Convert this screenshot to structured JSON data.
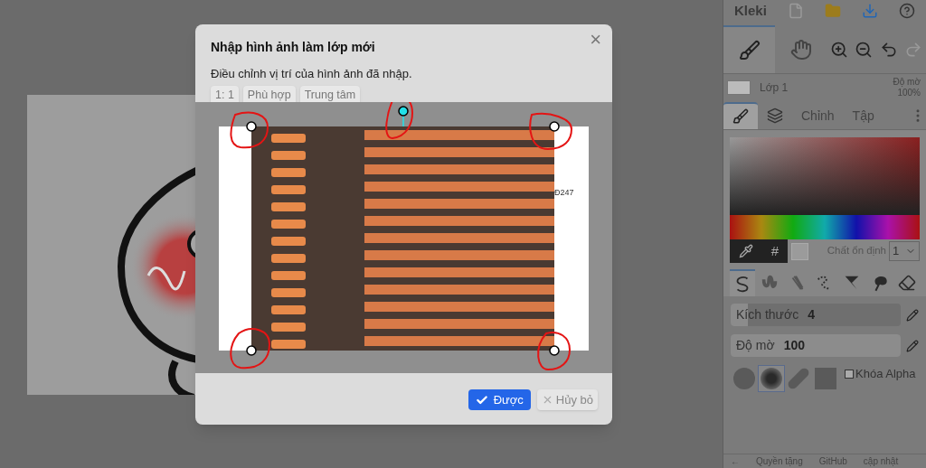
{
  "dialog": {
    "title": "Nhập hình ảnh làm lớp mới",
    "subtitle": "Điều chỉnh vị trí của hình ảnh đã nhập.",
    "close": "×",
    "fit_buttons": [
      "1: 1",
      "Phù hợp",
      "Trung tâm"
    ],
    "canvas_label": "Đ247",
    "ok": "Được",
    "cancel": "Hủy bỏ"
  },
  "sidebar": {
    "logo": "Kleki",
    "tools": [
      {
        "kind": "brush",
        "selected": true
      },
      {
        "kind": "hand",
        "selected": false
      }
    ],
    "layer": {
      "name": "Lớp 1",
      "opacity_label": "Độ mờ",
      "opacity_value": "100%"
    },
    "tabs": [
      {
        "kind": "brush",
        "selected": true
      },
      {
        "kind": "layers",
        "selected": false
      },
      {
        "kind": "text",
        "label": "Chỉnh",
        "selected": false
      },
      {
        "kind": "text",
        "label": "Tập",
        "selected": false
      }
    ],
    "hex_symbol": "#",
    "stabilizer": {
      "label": "Chất ổn định",
      "value": "1"
    },
    "brushes": [
      {
        "kind": "pen",
        "selected": true
      },
      {
        "kind": "blend",
        "selected": false
      },
      {
        "kind": "sketchy",
        "selected": false
      },
      {
        "kind": "pixel",
        "selected": false
      },
      {
        "kind": "chemy",
        "selected": false
      },
      {
        "kind": "smudge",
        "selected": false
      },
      {
        "kind": "eraser",
        "selected": false
      }
    ],
    "sliders": [
      {
        "label": "Kích thước",
        "value": "4",
        "level": 0.1
      },
      {
        "label": "Độ mờ",
        "value": "100",
        "level": 1
      }
    ],
    "shapes": [
      {
        "kind": "circle",
        "selected": false
      },
      {
        "kind": "soft",
        "selected": true
      },
      {
        "kind": "pill",
        "selected": false
      },
      {
        "kind": "square",
        "selected": false
      }
    ],
    "lock_alpha": {
      "label": "Khóa Alpha",
      "checked": false
    },
    "footer": [
      "←",
      "Quyền tặng",
      "GitHub",
      "cập nhật"
    ]
  }
}
